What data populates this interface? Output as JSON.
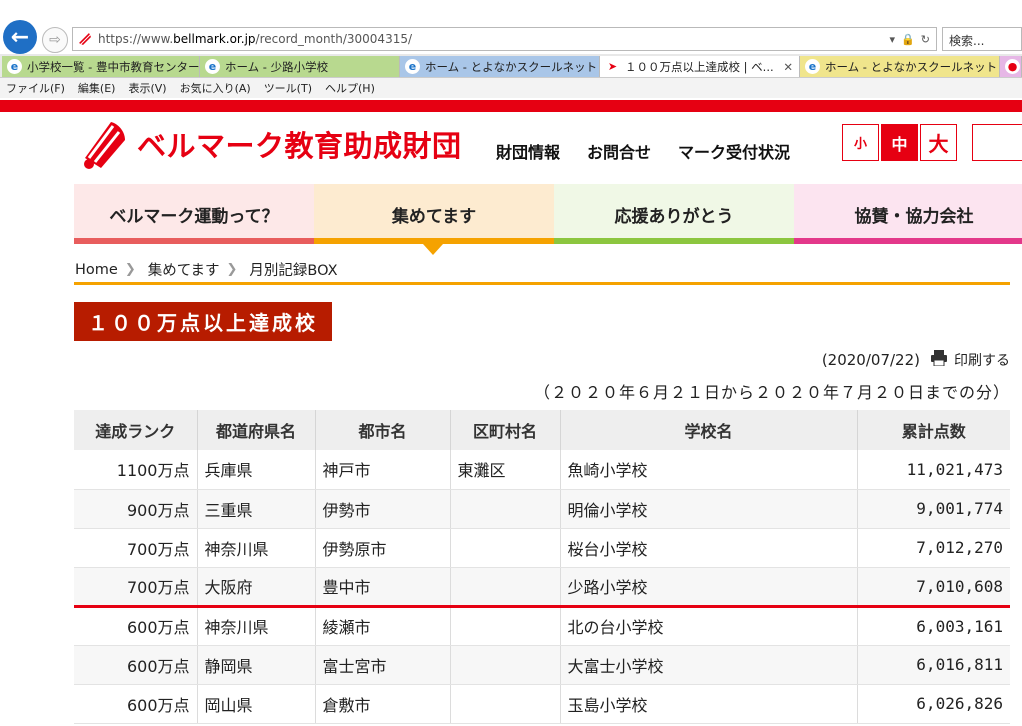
{
  "browser": {
    "url_prefix": "https://www.",
    "url_host": "bellmark.or.jp",
    "url_path": "/record_month/30004315/",
    "search_placeholder": "検索...",
    "tabs": [
      {
        "label": "小学校一覧 - 豊中市教育センター",
        "color": "#b8d98f"
      },
      {
        "label": "ホーム - 少路小学校",
        "color": "#b8d98f"
      },
      {
        "label": "ホーム - とよなかスクールネット",
        "color": "#a9c6e8"
      },
      {
        "label": "１００万点以上達成校 | ベ...",
        "color": "#ffffff",
        "active": true
      },
      {
        "label": "ホーム - とよなかスクールネット",
        "color": "#f0e58c"
      },
      {
        "label": "",
        "color": "#e6b7e6"
      }
    ],
    "menu": [
      "ファイル(F)",
      "編集(E)",
      "表示(V)",
      "お気に入り(A)",
      "ツール(T)",
      "ヘルプ(H)"
    ]
  },
  "site": {
    "logo_text": "ベルマーク教育助成財団",
    "header_links": [
      "財団情報",
      "お問合せ",
      "マーク受付状況"
    ],
    "font_sizes": [
      "小",
      "中",
      "大"
    ],
    "main_nav": [
      "ベルマーク運動って？",
      "集めてます",
      "応援ありがとう",
      "協賛・協力会社"
    ]
  },
  "breadcrumb": [
    "Home",
    "集めてます",
    "月別記録BOX"
  ],
  "page": {
    "title": "１００万点以上達成校",
    "date": "(2020/07/22)",
    "print_label": "印刷する",
    "period": "（２０２０年６月２１日から２０２０年７月２０日までの分）"
  },
  "table": {
    "headers": [
      "達成ランク",
      "都道府県名",
      "都市名",
      "区町村名",
      "学校名",
      "累計点数"
    ],
    "rows": [
      [
        "1100万点",
        "兵庫県",
        "神戸市",
        "東灘区",
        "魚崎小学校",
        "11,021,473"
      ],
      [
        "900万点",
        "三重県",
        "伊勢市",
        "",
        "明倫小学校",
        "9,001,774"
      ],
      [
        "700万点",
        "神奈川県",
        "伊勢原市",
        "",
        "桜台小学校",
        "7,012,270"
      ],
      [
        "700万点",
        "大阪府",
        "豊中市",
        "",
        "少路小学校",
        "7,010,608"
      ],
      [
        "600万点",
        "神奈川県",
        "綾瀬市",
        "",
        "北の台小学校",
        "6,003,161"
      ],
      [
        "600万点",
        "静岡県",
        "富士宮市",
        "",
        "大富士小学校",
        "6,016,811"
      ],
      [
        "600万点",
        "岡山県",
        "倉敷市",
        "",
        "玉島小学校",
        "6,026,826"
      ]
    ]
  },
  "colors": {
    "brand_red": "#e60012",
    "title_bg": "#b71c00",
    "accent_orange": "#f5a200"
  }
}
